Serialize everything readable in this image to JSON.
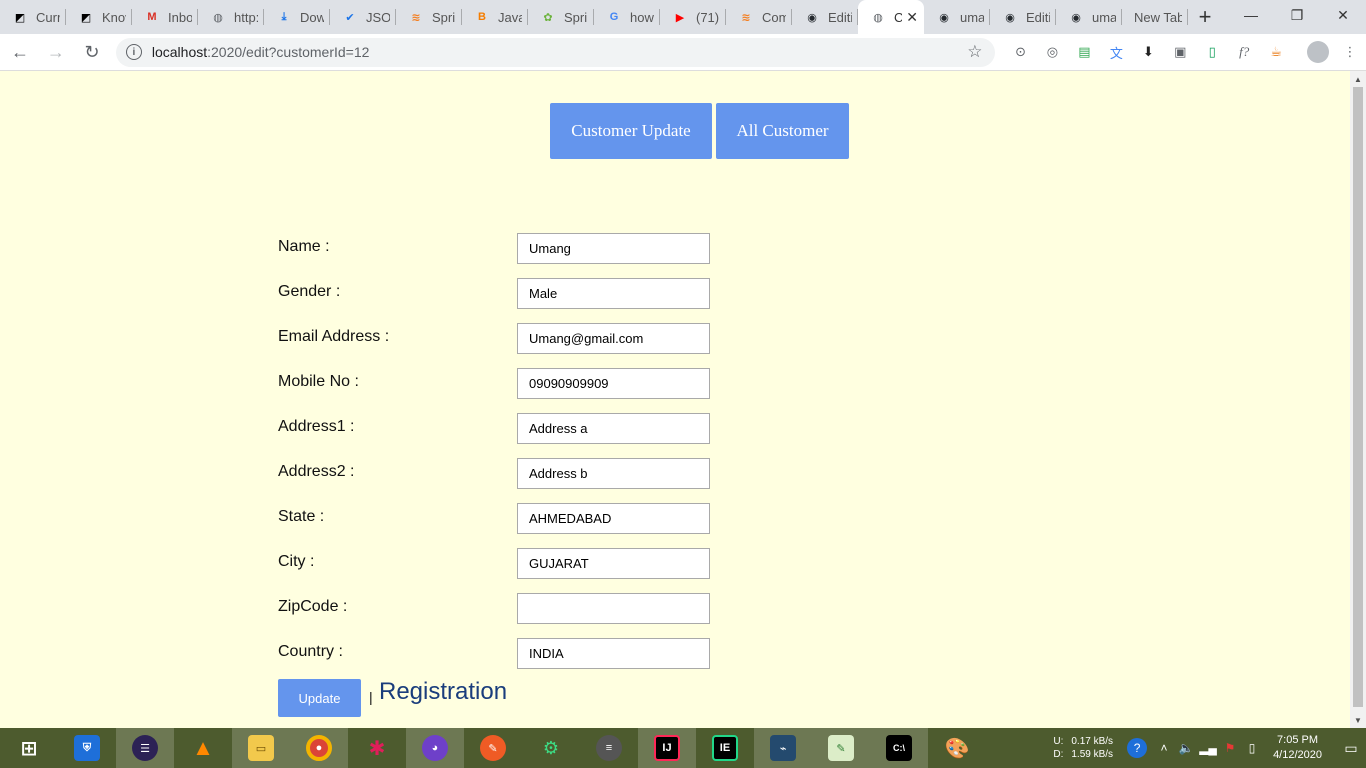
{
  "browser": {
    "tabs": [
      {
        "label": "Curr",
        "icon": "notion-icon",
        "color": "#000000",
        "glyph": "◩"
      },
      {
        "label": "Knov",
        "icon": "notion-icon",
        "color": "#000000",
        "glyph": "◩"
      },
      {
        "label": "Inbo",
        "icon": "gmail-icon",
        "color": "#d93025",
        "glyph": "M"
      },
      {
        "label": "http:",
        "icon": "globe-icon",
        "color": "#5f6368",
        "glyph": "◍"
      },
      {
        "label": "Dow",
        "icon": "download-icon",
        "color": "#1a73e8",
        "glyph": "⤓"
      },
      {
        "label": "JSON",
        "icon": "checkbox-icon",
        "color": "#1a73e8",
        "glyph": "✔"
      },
      {
        "label": "Sprir",
        "icon": "stackoverflow-icon",
        "color": "#f48024",
        "glyph": "≋"
      },
      {
        "label": "Java",
        "icon": "blogger-icon",
        "color": "#f57d00",
        "glyph": "B"
      },
      {
        "label": "Sprir",
        "icon": "spring-icon",
        "color": "#6db33f",
        "glyph": "✿"
      },
      {
        "label": "how",
        "icon": "google-icon",
        "color": "#4285f4",
        "glyph": "G"
      },
      {
        "label": "(71)",
        "icon": "youtube-icon",
        "color": "#ff0000",
        "glyph": "▶"
      },
      {
        "label": "Com",
        "icon": "stackoverflow-icon",
        "color": "#f48024",
        "glyph": "≋"
      },
      {
        "label": "Editi",
        "icon": "github-icon",
        "color": "#24292e",
        "glyph": "◉"
      },
      {
        "label": "C",
        "icon": "globe-icon",
        "color": "#5f6368",
        "glyph": "◍",
        "active": true
      },
      {
        "label": "uma",
        "icon": "github-icon",
        "color": "#24292e",
        "glyph": "◉"
      },
      {
        "label": "Editi",
        "icon": "github-icon",
        "color": "#24292e",
        "glyph": "◉"
      },
      {
        "label": "uma",
        "icon": "github-icon",
        "color": "#24292e",
        "glyph": "◉"
      },
      {
        "label": "New Tab",
        "icon": "",
        "color": "#5f6368",
        "glyph": ""
      }
    ],
    "url_host": "localhost",
    "url_path": ":2020/edit?customerId=12"
  },
  "nav": {
    "customer_update": "Customer Update",
    "all_customer": "All Customer"
  },
  "form": {
    "fields": [
      {
        "label": "Name :",
        "value": "Umang"
      },
      {
        "label": "Gender :",
        "value": "Male"
      },
      {
        "label": "Email Address :",
        "value": "Umang@gmail.com"
      },
      {
        "label": "Mobile No :",
        "value": "09090909909"
      },
      {
        "label": "Address1 :",
        "value": "Address a"
      },
      {
        "label": "Address2 :",
        "value": "Address b"
      },
      {
        "label": "State :",
        "value": "AHMEDABAD"
      },
      {
        "label": "City :",
        "value": "GUJARAT"
      },
      {
        "label": "ZipCode :",
        "value": ""
      },
      {
        "label": "Country :",
        "value": "INDIA"
      }
    ],
    "update_label": "Update",
    "separator": "|",
    "registration_link": "Registration"
  },
  "taskbar": {
    "upload_label": "U:",
    "download_label": "D:",
    "upload_speed": "0.17 kB/s",
    "download_speed": "1.59 kB/s",
    "time": "7:05 PM",
    "date": "4/12/2020"
  }
}
